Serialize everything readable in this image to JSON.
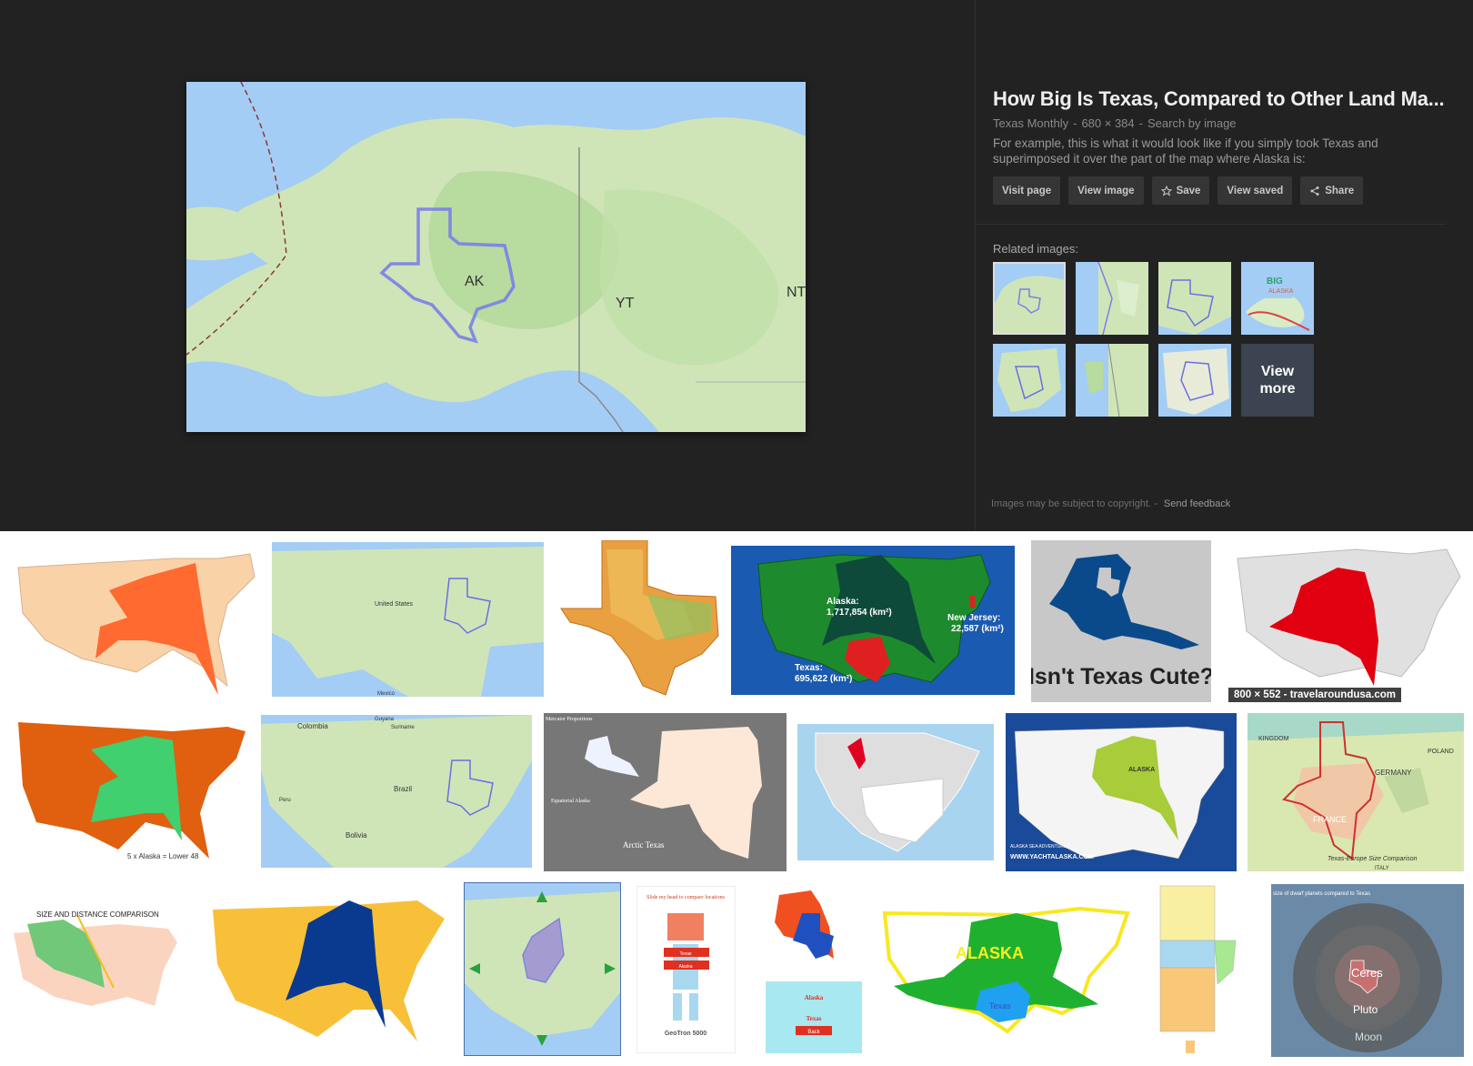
{
  "main_image": {
    "labels": [
      "AK",
      "YT",
      "NT"
    ]
  },
  "panel": {
    "title": "How Big Is Texas, Compared to Other Land Ma...",
    "source": "Texas Monthly",
    "dimensions": "680 × 384",
    "search_by_image": "Search by image",
    "separator": "-",
    "description": "For example, this is what it would look like if you simply took Texas and superimposed it over the part of the map where Alaska is:",
    "buttons": {
      "visit": "Visit page",
      "view_image": "View image",
      "save": "Save",
      "view_saved": "View saved",
      "share": "Share"
    },
    "related_label": "Related images:",
    "view_more": [
      "View",
      "more"
    ],
    "footer_copyright": "Images may be subject to copyright.",
    "footer_separator": "-",
    "footer_feedback": "Send feedback"
  },
  "results": {
    "r1c4": [
      "Alaska:",
      "1,717,854 (km²)",
      "New Jersey:",
      "22,587 (km²)",
      "Texas:",
      "695,622 (km²)"
    ],
    "r1c5": "Isn't Texas Cute?",
    "r1c6_size": "800 × 552 - travelaroundusa.com",
    "r1c2": [
      "United States",
      "Mexico"
    ],
    "r2c1": "5 x Alaska = Lower 48",
    "r2c2": [
      "Colombia",
      "Brazil",
      "Bolivia",
      "Suriname",
      "Guyana",
      "Peru"
    ],
    "r2c3": [
      "Mercator Proportions",
      "Equatorial Alaska",
      "Arctic Texas"
    ],
    "r2c5": [
      "ALASKA",
      "ALASKA SEA ADVENTURES",
      "WWW.YACHTALASKA.COM"
    ],
    "r2c6": [
      "FRANCE",
      "GERMANY",
      "POLAND",
      "KINGDOM",
      "Texas-Europe Size Comparison",
      "ITALY"
    ],
    "r3c1": "SIZE AND DISTANCE COMPARISON",
    "r3c4": [
      "Slide my head to compare locations",
      "Texas",
      "Alaska",
      "GeoTron 5000"
    ],
    "r3c5": [
      "Alaska",
      "Texas",
      "Back"
    ],
    "r3c6": [
      "ALASKA",
      "Texas"
    ],
    "r3c8": [
      "size of dwarf planets compared to Texas",
      "Ceres",
      "Pluto",
      "Moon"
    ]
  },
  "colors": {
    "viewer_bg": "#222222",
    "button_bg": "#353535",
    "ocean": "#a3cdf5",
    "land": "#cfe5b8",
    "texas_outline": "#7b7ee8"
  }
}
